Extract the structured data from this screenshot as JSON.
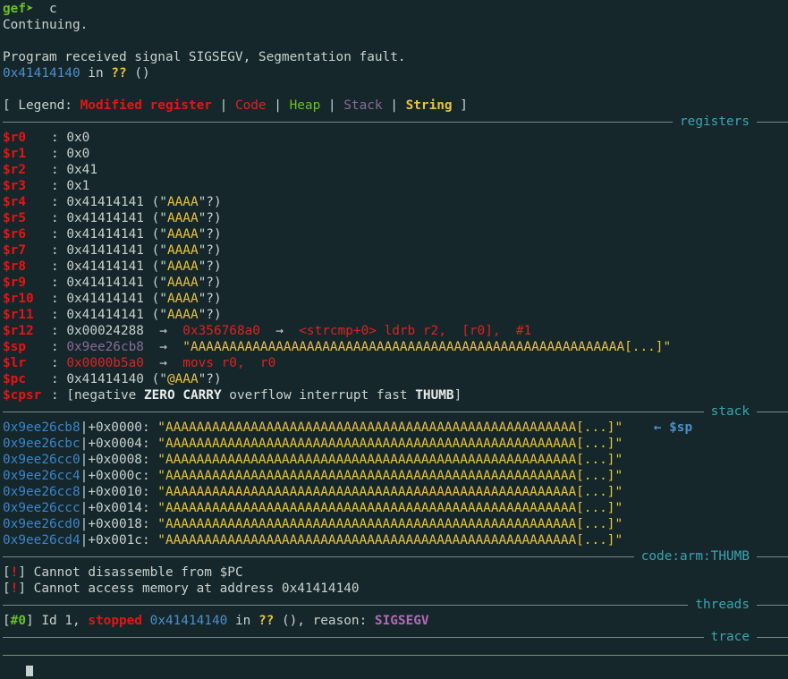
{
  "prompt": {
    "gef": "gef",
    "arrow": "➤",
    "cmd": "c"
  },
  "continuing": "Continuing.",
  "signal_msg": "Program received signal SIGSEGV, Segmentation fault.",
  "pc_line": {
    "addr": "0x41414140",
    "in": " in ",
    "func": "??",
    "args": " ()"
  },
  "legend": {
    "open": "[ Legend: ",
    "modified": "Modified register",
    "code": "Code",
    "heap": "Heap",
    "stack": "Stack",
    "string": "String",
    "close": " ]",
    "sep": " | "
  },
  "section_titles": {
    "registers": "registers",
    "stack": "stack",
    "code": "code:arm:THUMB",
    "threads": "threads",
    "trace": "trace"
  },
  "registers": [
    {
      "name": "$r0",
      "val": "0x0",
      "str": ""
    },
    {
      "name": "$r1",
      "val": "0x0",
      "str": ""
    },
    {
      "name": "$r2",
      "val": "0x41",
      "str": ""
    },
    {
      "name": "$r3",
      "val": "0x1",
      "str": ""
    },
    {
      "name": "$r4",
      "val": "0x41414141",
      "str": "AAAA"
    },
    {
      "name": "$r5",
      "val": "0x41414141",
      "str": "AAAA"
    },
    {
      "name": "$r6",
      "val": "0x41414141",
      "str": "AAAA"
    },
    {
      "name": "$r7",
      "val": "0x41414141",
      "str": "AAAA"
    },
    {
      "name": "$r8",
      "val": "0x41414141",
      "str": "AAAA"
    },
    {
      "name": "$r9",
      "val": "0x41414141",
      "str": "AAAA"
    },
    {
      "name": "$r10",
      "val": "0x41414141",
      "str": "AAAA"
    },
    {
      "name": "$r11",
      "val": "0x41414141",
      "str": "AAAA"
    }
  ],
  "r12": {
    "name": "$r12",
    "val": "0x00024288",
    "arrow": "→",
    "ptr": "0x356768a0",
    "sym": "<strcmp+0>",
    "insn": " ldrb r2,  [r0],  #1"
  },
  "sp": {
    "name": "$sp",
    "val": "0x9ee26cb8",
    "arrow": "→",
    "str": "\"AAAAAAAAAAAAAAAAAAAAAAAAAAAAAAAAAAAAAAAAAAAAAAAAAAAAAAAA[...]\""
  },
  "lr": {
    "name": "$lr",
    "val": "0x0000b5a0",
    "arrow": "→",
    "insn": "movs r0,  r0"
  },
  "pc": {
    "name": "$pc",
    "val": "0x41414140",
    "open": " (\"",
    "str": "@AAA",
    "close": "\"?)"
  },
  "cpsr": {
    "name": "$cpsr",
    "open": "[",
    "f1": "negative ",
    "f2": "ZERO",
    "f3": " ",
    "f4": "CARRY",
    "f5": " overflow interrupt fast ",
    "f6": "THUMB",
    "close": "]"
  },
  "stack_rows": [
    {
      "addr": "0x9ee26cb8",
      "off": "+0x0000",
      "val": "\"AAAAAAAAAAAAAAAAAAAAAAAAAAAAAAAAAAAAAAAAAAAAAAAAAAAAA[...]\"",
      "note": "← $sp"
    },
    {
      "addr": "0x9ee26cbc",
      "off": "+0x0004",
      "val": "\"AAAAAAAAAAAAAAAAAAAAAAAAAAAAAAAAAAAAAAAAAAAAAAAAAAAAA[...]\"",
      "note": ""
    },
    {
      "addr": "0x9ee26cc0",
      "off": "+0x0008",
      "val": "\"AAAAAAAAAAAAAAAAAAAAAAAAAAAAAAAAAAAAAAAAAAAAAAAAAAAAA[...]\"",
      "note": ""
    },
    {
      "addr": "0x9ee26cc4",
      "off": "+0x000c",
      "val": "\"AAAAAAAAAAAAAAAAAAAAAAAAAAAAAAAAAAAAAAAAAAAAAAAAAAAAA[...]\"",
      "note": ""
    },
    {
      "addr": "0x9ee26cc8",
      "off": "+0x0010",
      "val": "\"AAAAAAAAAAAAAAAAAAAAAAAAAAAAAAAAAAAAAAAAAAAAAAAAAAAAA[...]\"",
      "note": ""
    },
    {
      "addr": "0x9ee26ccc",
      "off": "+0x0014",
      "val": "\"AAAAAAAAAAAAAAAAAAAAAAAAAAAAAAAAAAAAAAAAAAAAAAAAAAAAA[...]\"",
      "note": ""
    },
    {
      "addr": "0x9ee26cd0",
      "off": "+0x0018",
      "val": "\"AAAAAAAAAAAAAAAAAAAAAAAAAAAAAAAAAAAAAAAAAAAAAAAAAAAAA[...]\"",
      "note": ""
    },
    {
      "addr": "0x9ee26cd4",
      "off": "+0x001c",
      "val": "\"AAAAAAAAAAAAAAAAAAAAAAAAAAAAAAAAAAAAAAAAAAAAAAAAAAAAA[...]\"",
      "note": ""
    }
  ],
  "code_msgs": [
    {
      "tag": "!",
      "text": " Cannot disassemble from $PC"
    },
    {
      "tag": "!",
      "text": " Cannot access memory at address 0x41414140"
    }
  ],
  "thread": {
    "id": "#0",
    "id_text": " Id 1, ",
    "state": "stopped",
    "addr": "0x41414140",
    "in": " in ",
    "func": "??",
    "rest": " (), reason: ",
    "reason": "SIGSEGV"
  },
  "colors": {
    "background": "#16272b",
    "modified": "#e61414",
    "code": "#d9241f",
    "heap": "#6abf2a",
    "stack": "#8a6a9a",
    "string": "#e8c33d",
    "section": "#3aa4b4"
  }
}
